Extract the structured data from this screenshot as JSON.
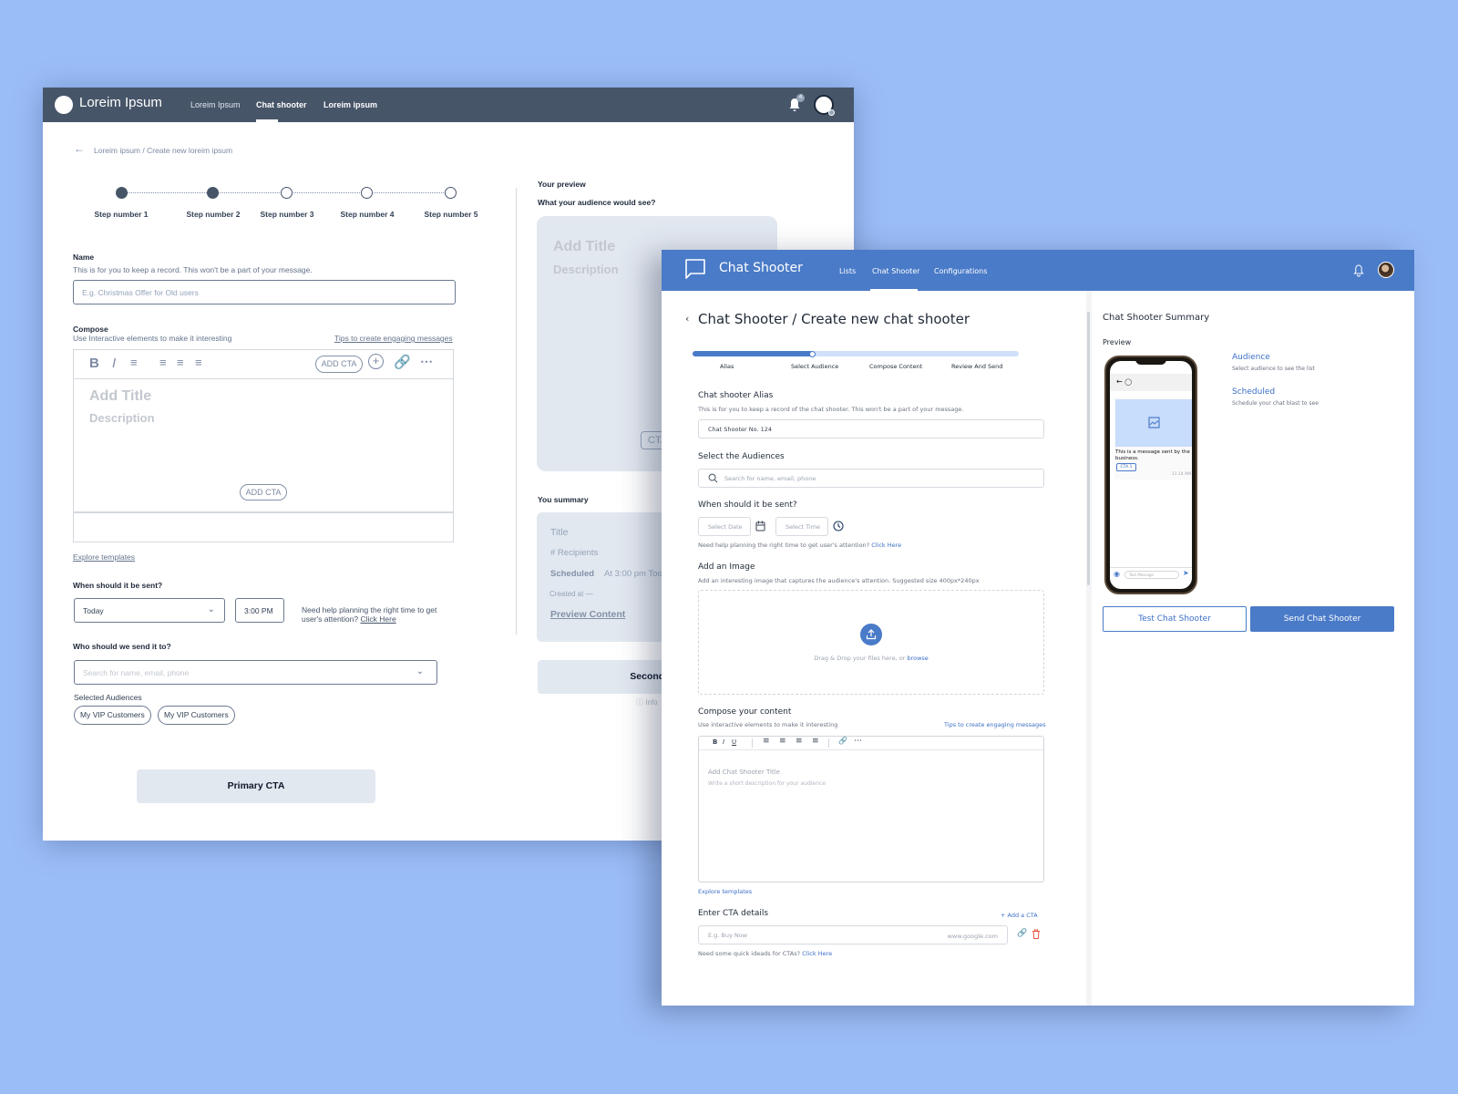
{
  "back_window": {
    "nav": {
      "brand": "Loreim Ipsum",
      "items": [
        {
          "label": "Loreim Ipsum",
          "active": false
        },
        {
          "label": "Chat shooter",
          "active": true
        },
        {
          "label": "Loreim ipsum",
          "active": false
        }
      ],
      "notification_count": "4"
    },
    "breadcrumb": "Loreim ipsum / Create new loreim ipsum",
    "steps": [
      {
        "label": "Step number 1",
        "done": true
      },
      {
        "label": "Step number 2",
        "done": true
      },
      {
        "label": "Step number 3",
        "done": false
      },
      {
        "label": "Step number 4",
        "done": false
      },
      {
        "label": "Step number 5",
        "done": false
      }
    ],
    "name": {
      "label": "Name",
      "help": "This is for you to keep a record. This won't be a part of your message.",
      "placeholder": "E.g. Christmas Offer for Old users"
    },
    "compose": {
      "label": "Compose",
      "help": "Use Interactive elements to make it interesting",
      "tips_link": "Tips to create engaging messages",
      "toolbar_cta": "ADD CTA",
      "title_placeholder": "Add Title",
      "desc_placeholder": "Description",
      "inline_cta": "ADD CTA",
      "explore": "Explore templates"
    },
    "schedule": {
      "label": "When should it be sent?",
      "day": "Today",
      "time": "3:00 PM",
      "help": "Need help planning the right time to get user's attention?",
      "help_link": "Click Here"
    },
    "recipients": {
      "label": "Who should we send it to?",
      "placeholder": "Search for name, email, phone",
      "selected_label": "Selected Audiences",
      "chips": [
        "My VIP Customers",
        "My VIP Customers"
      ]
    },
    "primary_cta": "Primary CTA",
    "preview": {
      "heading": "Your preview",
      "subheading": "What your audience would see?",
      "title": "Add Title",
      "desc": "Description",
      "cta": "CTA"
    },
    "summary": {
      "heading": "You summary",
      "title": "Title",
      "recipients": "# Recipients",
      "scheduled_label": "Scheduled",
      "scheduled_value": "At 3:00 pm Too",
      "created": "Created at —",
      "preview_link": "Preview Content"
    },
    "secondary_cta": "Secondary CTA",
    "info_text": "Info"
  },
  "front_window": {
    "nav": {
      "brand": "Chat Shooter",
      "items": [
        {
          "label": "Lists",
          "active": false
        },
        {
          "label": "Chat Shooter",
          "active": true
        },
        {
          "label": "Configurations",
          "active": false
        }
      ]
    },
    "page_title": "Chat Shooter / Create new chat shooter",
    "progress": {
      "value": 0.37,
      "steps": [
        "Alias",
        "Select Audience",
        "Compose Content",
        "Review And Send"
      ]
    },
    "alias": {
      "label": "Chat shooter Alias",
      "help": "This is for you to keep a record of the chat shooter. This won't be a part of your message.",
      "value": "Chat Shooter No. 124"
    },
    "audiences": {
      "label": "Select the Audiences",
      "placeholder": "Search for name, email, phone"
    },
    "schedule": {
      "label": "When should it be sent?",
      "date_placeholder": "Select Date",
      "time_placeholder": "Select Time",
      "help": "Need help planning the right time to get user's attention?",
      "help_link": "Click Here"
    },
    "image": {
      "label": "Add an Image",
      "help": "Add an interesting image that captures the audience's attention. Suggested size 400px*240px",
      "drop_text": "Drag & Drop your files here, or",
      "browse": "browse"
    },
    "compose": {
      "label": "Compose your content",
      "help": "Use interactive elements to make it interesting",
      "tips_link": "Tips to create engaging messages",
      "title_placeholder": "Add Chat Shooter Title",
      "desc_placeholder": "Write a short description for your audience",
      "explore": "Explore templates"
    },
    "cta": {
      "label": "Enter CTA details",
      "add": "Add a CTA",
      "text_placeholder": "E.g. Buy Now",
      "url_placeholder": "www.google.com",
      "help": "Need some quick ideads for CTAs?",
      "help_link": "Click Here"
    },
    "summary": {
      "heading": "Chat Shooter Summary",
      "preview_label": "Preview",
      "message": "This is a message sent by the business.",
      "message_cta": "CTA 1",
      "message_time": "11.14 AM",
      "input_placeholder": "Text Message",
      "audience_title": "Audience",
      "audience_help": "Select audience to see the list",
      "scheduled_title": "Scheduled",
      "scheduled_help": "Schedule your chat blast to see",
      "test_button": "Test Chat Shooter",
      "send_button": "Send Chat Shooter"
    }
  }
}
